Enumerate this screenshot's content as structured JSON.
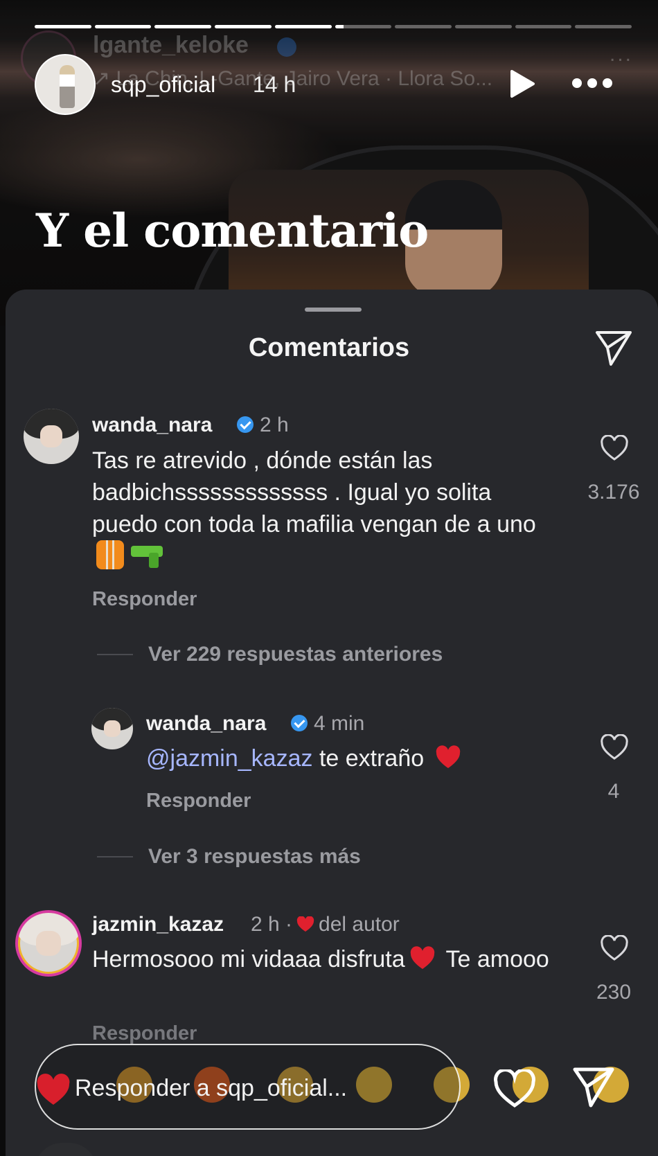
{
  "story": {
    "progress": {
      "segments": 10,
      "current_index": 5,
      "current_fill": 0.15
    },
    "ghost_header": {
      "username": "lgante_keloke",
      "music": "↗ La Chin, L-Gante, Jairo Vera · Llora So...",
      "more": "..."
    },
    "header": {
      "username": "sqp_oficial",
      "time": "14 h"
    },
    "text_overlay": "Y el comentario"
  },
  "comments_sheet": {
    "title": "Comentarios",
    "comments": [
      {
        "username": "wanda_nara",
        "verified": true,
        "time": "2 h",
        "text_before": "Tas re atrevido , dónde están las badbichsssssssssssss . Igual yo solita puedo con toda la mafilia vengan de a uno",
        "emojis": [
          "safety-vest-emoji",
          "water-pistol-emoji"
        ],
        "reply_label": "Responder",
        "likes": "3.176"
      }
    ],
    "view_previous": "Ver 229 respuestas anteriores",
    "reply": {
      "username": "wanda_nara",
      "verified": true,
      "time": "4 min",
      "mention": "@jazmin_kazaz",
      "text": " te extraño ",
      "emoji": "red-heart-emoji",
      "reply_label": "Responder",
      "likes": "4"
    },
    "view_more": "Ver 3 respuestas más",
    "comment2": {
      "username": "jazmin_kazaz",
      "time": "2 h ·",
      "author_badge": "del autor",
      "text_a": "Hermosooo mi vidaaa disfruta",
      "text_b": " Te amooo",
      "reply_label": "Responder",
      "likes": "230"
    }
  },
  "reply_bar": {
    "placeholder": "Responder a sqp_oficial...",
    "icons": [
      "heart-outline-icon",
      "send-icon"
    ],
    "quick_reactions": [
      "red-heart-emoji",
      "raised-hands-emoji",
      "fire-emoji",
      "clapping-emoji",
      "crying-emoji",
      "heart-eyes-emoji",
      "surprised-emoji",
      "laughing-emoji"
    ]
  },
  "colors": {
    "sheet_bg": "#27282c",
    "verified_blue": "#3797f0",
    "mention": "#a7b7ff",
    "heart_red": "#e0202e",
    "muted": "#a8a8ad"
  }
}
